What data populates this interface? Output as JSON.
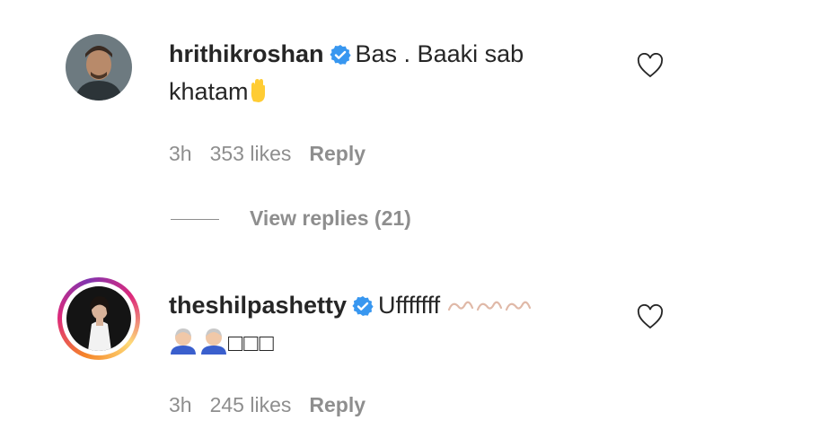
{
  "comments": [
    {
      "username": "hrithikroshan",
      "text_line1": "Bas . Baaki sab",
      "text_line2": "khatam",
      "time": "3h",
      "likes": "353 likes",
      "reply": "Reply",
      "verified_icon": "verified-badge",
      "emoji_icon": "raised-hand-emoji"
    },
    {
      "username": "theshilpashetty",
      "text_line1": "Ufffffff",
      "text_line2": "□□□",
      "time": "3h",
      "likes": "245 likes",
      "reply": "Reply",
      "verified_icon": "verified-badge",
      "emoji_icon": "face-emoji"
    }
  ],
  "view_replies": "View replies (21)",
  "colors": {
    "verified": "#3897f0",
    "meta_text": "#8e8e8e",
    "primary_text": "#262626"
  }
}
